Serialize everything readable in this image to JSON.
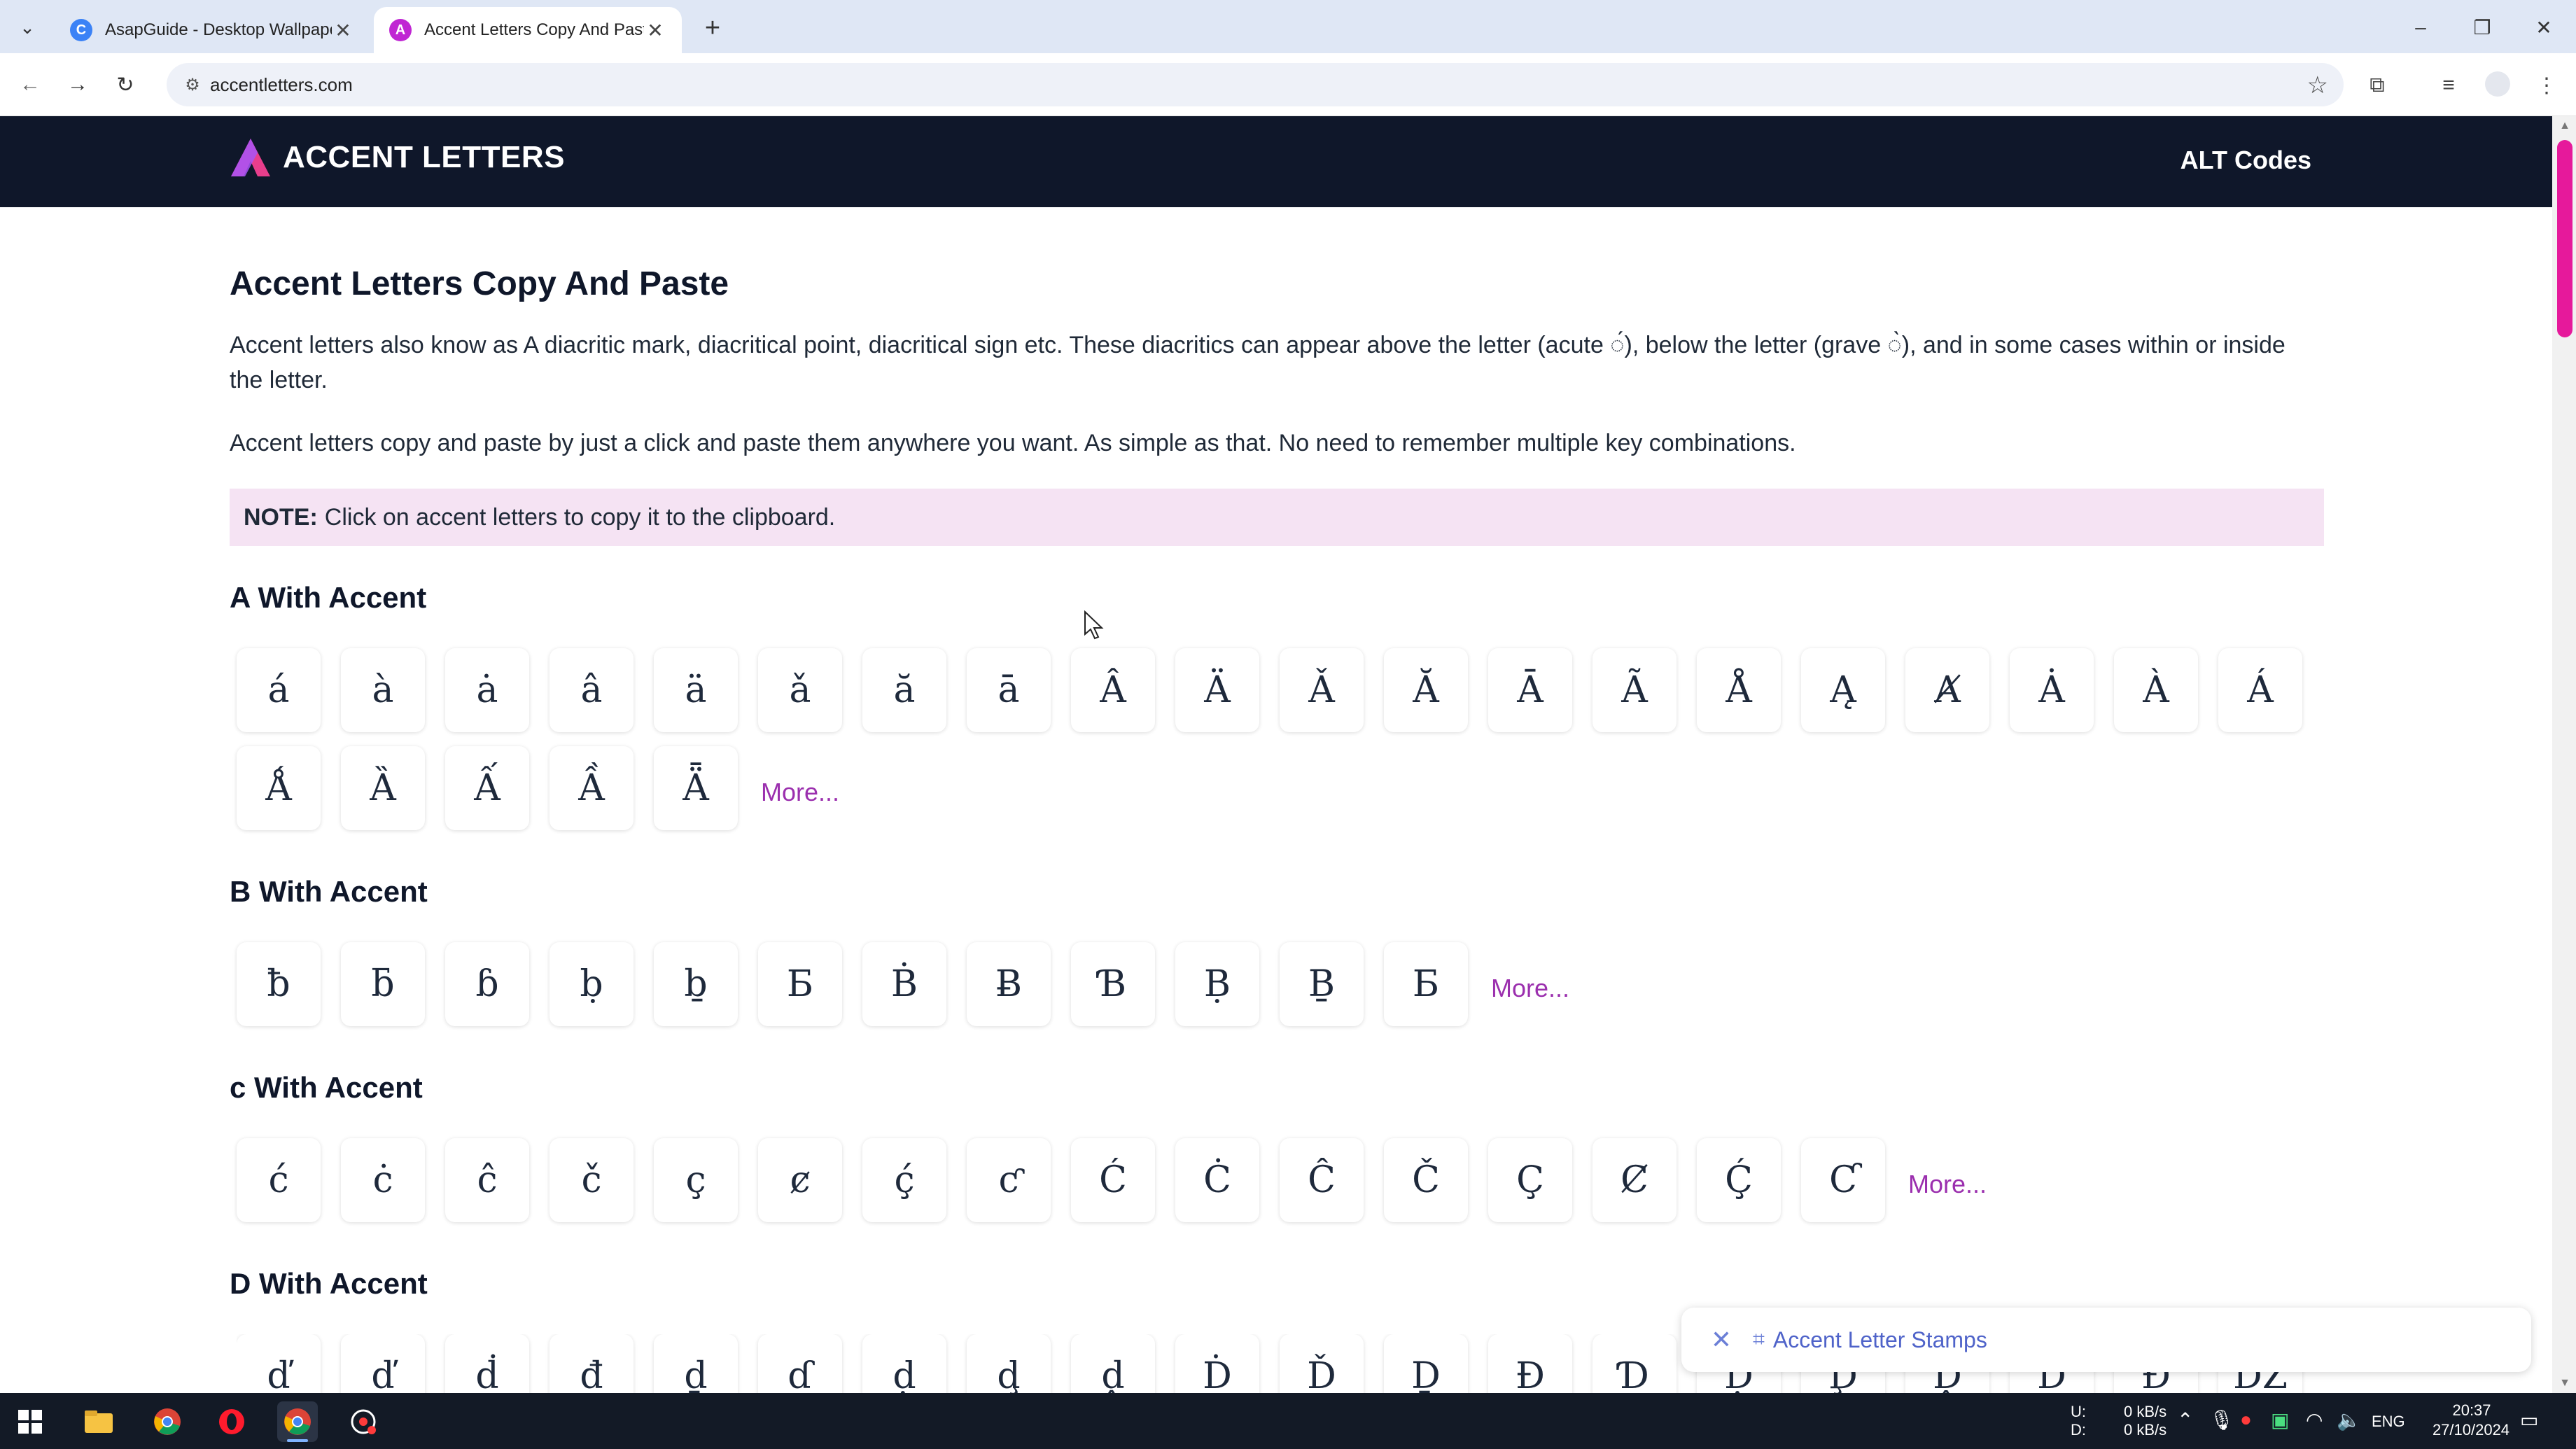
{
  "browser": {
    "tabs": [
      {
        "title": "AsapGuide - Desktop Wallpape",
        "active": false,
        "favicon_color": "#3b82f6",
        "favicon_glyph": "C"
      },
      {
        "title": "Accent Letters Copy And Paste",
        "active": true,
        "favicon_color": "#c026d3",
        "favicon_glyph": "A"
      }
    ],
    "url": "accentletters.com",
    "icons": {
      "tab_menu": "chevron-down-icon",
      "close": "close-icon",
      "new_tab": "plus-icon",
      "back": "back-arrow-icon",
      "forward": "forward-arrow-icon",
      "reload": "reload-icon",
      "site_info": "site-settings-icon",
      "bookmark": "star-icon",
      "extensions": "puzzle-icon",
      "media": "media-control-icon",
      "menu": "kebab-menu-icon"
    },
    "glyphs": {
      "tab_menu": "⌄",
      "close": "✕",
      "new_tab": "+",
      "back": "←",
      "forward": "→",
      "reload": "↻",
      "site_info": "⚙",
      "bookmark": "☆",
      "extensions": "⧉",
      "media": "≡",
      "menu": "⋮",
      "minimize": "–",
      "restore": "❐",
      "win_close": "✕"
    }
  },
  "site": {
    "brand": "ACCENT LETTERS",
    "nav_link": "ALT Codes",
    "brand_color": "#e83e8c",
    "header_bg": "#0f172a"
  },
  "main": {
    "title": "Accent Letters Copy And Paste",
    "intro": "Accent letters also know as A diacritic mark, diacritical point, diacritical sign etc. These diacritics can appear above the letter (acute ◌́), below the letter (grave ◌̀), and in some cases within or inside the letter.",
    "intro2": "Accent letters copy and paste by just a click and paste them anywhere you want. As simple as that. No need to remember multiple key combinations.",
    "note_label": "NOTE:",
    "note_text": "Click on accent letters to copy it to the clipboard.",
    "more_label": "More...",
    "sections": [
      {
        "title": "A With Accent",
        "letters": [
          "á",
          "à",
          "ȧ",
          "â",
          "ä",
          "ǎ",
          "ă",
          "ā",
          "Â",
          "Ä",
          "Ǎ",
          "Ă",
          "Ā",
          "Ã",
          "Å",
          "Ą",
          "Ⱥ",
          "Ȧ",
          "À",
          "Á",
          "Ǻ",
          "Ȁ",
          "Ấ",
          "Ầ",
          "Ǟ"
        ]
      },
      {
        "title": "B With Accent",
        "letters": [
          "ƀ",
          "ƃ",
          "ɓ",
          "ḅ",
          "ḇ",
          "Ƃ",
          "Ḃ",
          "Ƀ",
          "Ɓ",
          "Ḅ",
          "Ḇ",
          "Ƃ"
        ]
      },
      {
        "title": "c With Accent",
        "letters": [
          "ć",
          "ċ",
          "ĉ",
          "č",
          "ç",
          "ȼ",
          "ḉ",
          "ƈ",
          "Ć",
          "Ċ",
          "Ĉ",
          "Č",
          "Ç",
          "Ȼ",
          "Ḉ",
          "Ƈ"
        ]
      },
      {
        "title": "D With Accent",
        "letters": [
          "ď",
          "ď",
          "ḋ",
          "đ",
          "ḏ",
          "ɗ",
          "ḍ",
          "ḑ",
          "ḓ",
          "Ḋ",
          "Ď",
          "Ḏ",
          "Đ",
          "Ɗ",
          "Ḍ",
          "Ḑ",
          "Ḓ",
          "Ḋ",
          "Đ",
          "Ǆ"
        ]
      }
    ]
  },
  "stamp_bar": {
    "label": "Accent Letter Stamps",
    "close_icon": "close-icon",
    "tag_icon": "tag-icon",
    "close_glyph": "✕",
    "tag_glyph": "⌗"
  },
  "taskbar": {
    "net_up_label": "U:",
    "net_down_label": "D:",
    "net_up": "0 kB/s",
    "net_down": "0 kB/s",
    "language": "ENG",
    "time": "20:37",
    "date": "27/10/2024"
  }
}
